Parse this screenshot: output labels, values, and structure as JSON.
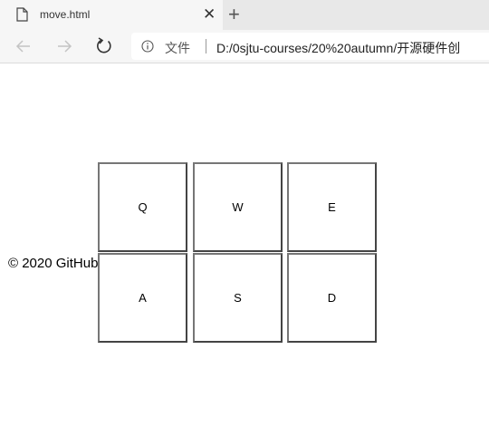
{
  "tab": {
    "title": "move.html",
    "close_icon": "close-icon"
  },
  "toolbar": {
    "site_label": "文件",
    "url": "D:/0sjtu-courses/20%20autumn/开源硬件创"
  },
  "content": {
    "footer": "© 2020 GitHub",
    "keys": [
      "Q",
      "W",
      "E",
      "A",
      "S",
      "D"
    ]
  },
  "colors": {
    "tab_strip": "#e8e8e8",
    "toolbar": "#f6f6f6",
    "key_border": "#767676"
  }
}
